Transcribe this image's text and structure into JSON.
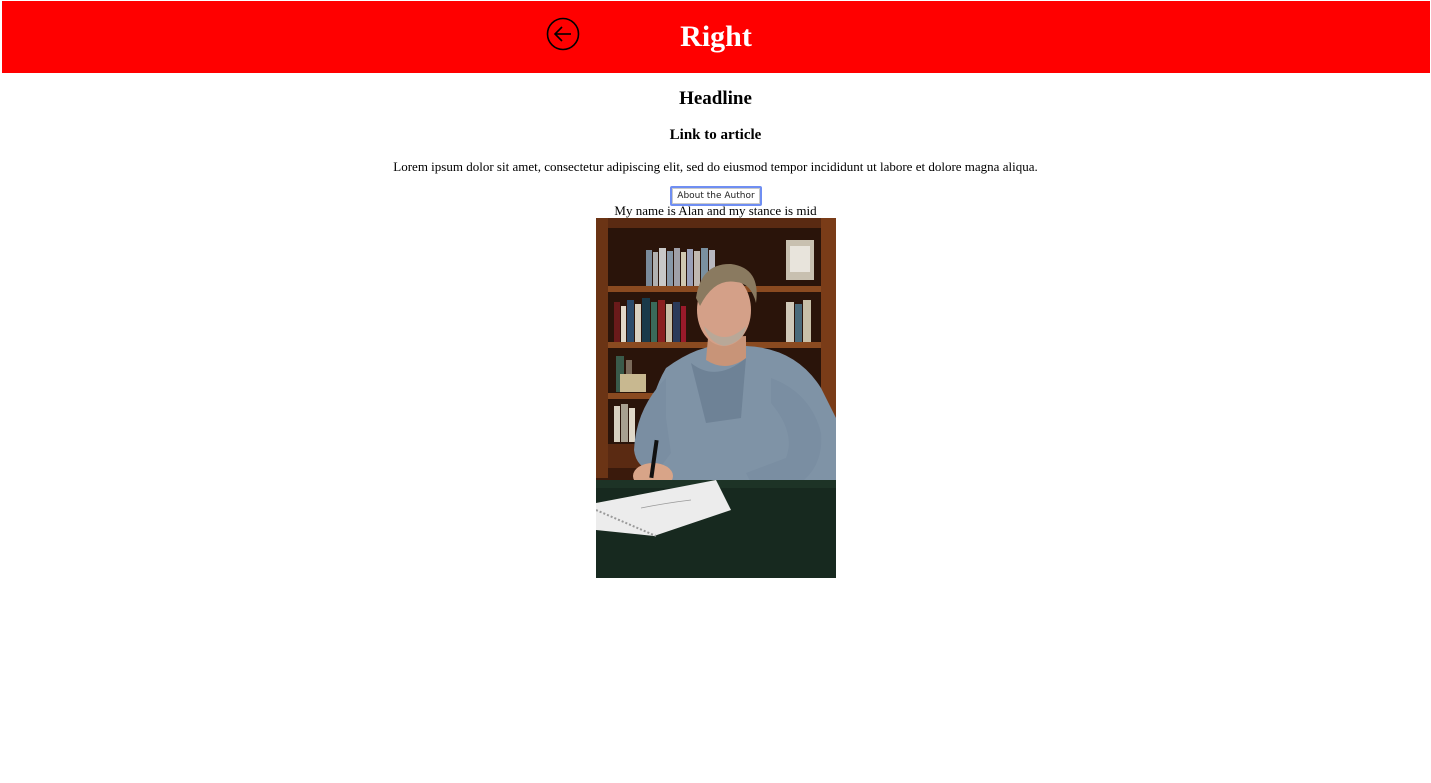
{
  "header": {
    "title": "Right",
    "background_color": "#ff0000",
    "back_icon": "arrow-left-circle-icon"
  },
  "article": {
    "headline": "Headline",
    "link_text": "Link to article",
    "body": "Lorem ipsum dolor sit amet, consectetur adipiscing elit, sed do eiusmod tempor incididunt ut labore et dolore magna aliqua."
  },
  "author": {
    "button_label": "About the Author",
    "bio": "My name is Alan and my stance is mid"
  }
}
